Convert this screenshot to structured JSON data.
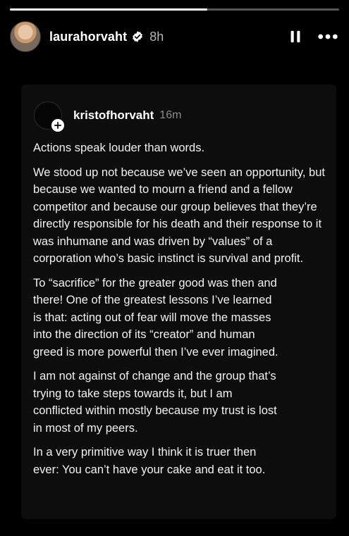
{
  "story": {
    "progress_fraction": 0.6,
    "username": "laurahorvaht",
    "time": "8h"
  },
  "post": {
    "username": "kristofhorvaht",
    "time": "16m",
    "paragraphs": [
      "Actions speak louder than words.",
      "We stood up not because we’ve seen an opportunity, but because we wanted to mourn a friend and a fellow competitor and because our group believes that they’re directly responsible for his death and their response to it was inhumane and was driven by “values” of a corporation who’s basic instinct is survival and profit.",
      "To “sacrifice” for the greater good was then and there! One of the greatest lessons I’ve learned is that: acting out of fear will move the masses into the direction of its “creator” and human greed is more powerful then I’ve ever imagined.",
      "I am not against of change and the group that’s trying to take steps towards it, but I am conflicted within mostly because my trust is lost in most of my peers.",
      "In a very primitive way I think it is truer then ever: You can’t have your cake and eat it too."
    ]
  },
  "icons": {
    "verified": "verified-badge-icon",
    "pause": "pause-icon",
    "more": "more-options-icon",
    "follow": "plus-icon"
  },
  "colors": {
    "background": "#000000",
    "progress_track": "#555555",
    "progress_fill": "#ffffff",
    "secondary_text": "#b7b7b7"
  }
}
